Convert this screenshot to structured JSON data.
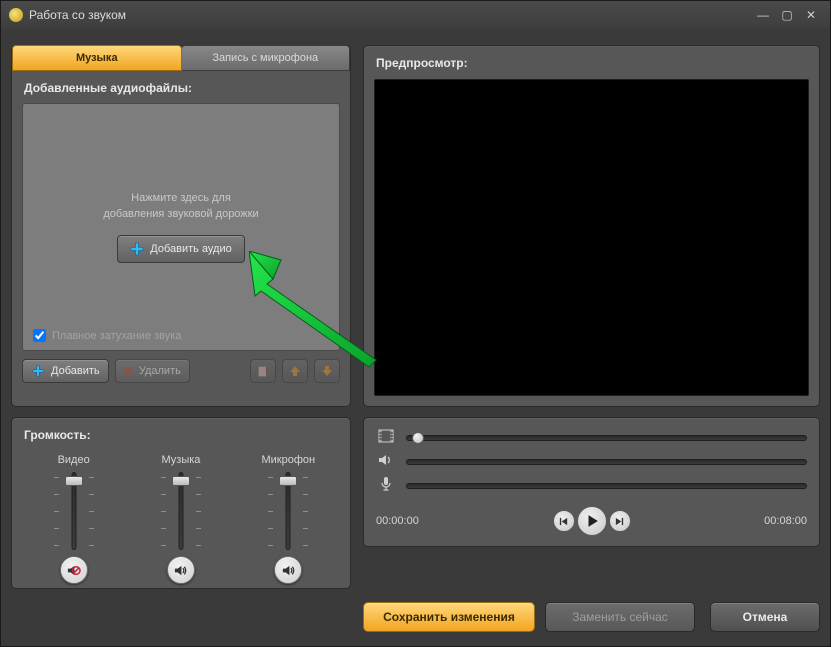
{
  "window": {
    "title": "Работа со звуком"
  },
  "tabs": {
    "music": "Музыка",
    "mic": "Запись с микрофона"
  },
  "audio_panel": {
    "title": "Добавленные аудиофайлы:",
    "hint_line1": "Нажмите здесь для",
    "hint_line2": "добавления звуковой дорожки",
    "add_audio": "Добавить аудио",
    "fade_label": "Плавное затухание звука",
    "add": "Добавить",
    "delete": "Удалить"
  },
  "volume": {
    "title": "Громкость:",
    "video": "Видео",
    "music": "Музыка",
    "mic": "Микрофон"
  },
  "preview": {
    "title": "Предпросмотр:"
  },
  "times": {
    "current": "00:00:00",
    "total": "00:08:00"
  },
  "buttons": {
    "save": "Сохранить изменения",
    "replace": "Заменить сейчас",
    "cancel": "Отмена"
  }
}
